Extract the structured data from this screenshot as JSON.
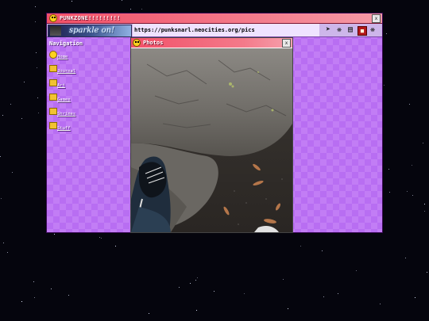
{
  "window": {
    "title": "PUNKZONE!!!!!!!!!",
    "close_label": "x"
  },
  "addressbar": {
    "banner_text": "sparkle on!",
    "url": "https://punksnarl.neocities.org/pics",
    "tools": [
      "cursor-icon",
      "bug-icon",
      "book-icon",
      "robot-icon",
      "spider-icon"
    ]
  },
  "navigation": {
    "heading": "Navigation",
    "items": [
      {
        "label": "Home",
        "icon": "smiley-icon"
      },
      {
        "label": "Journal",
        "icon": "folder-icon"
      },
      {
        "label": "Art",
        "icon": "folder-icon"
      },
      {
        "label": "Games",
        "icon": "folder-icon"
      },
      {
        "label": "Shrines",
        "icon": "folder-icon"
      },
      {
        "label": "Stuff",
        "icon": "folder-icon"
      }
    ]
  },
  "photos_window": {
    "title": "Photos",
    "close_label": "x"
  },
  "colors": {
    "titlebar": "#f25068",
    "checker_a": "#c27df5",
    "checker_b": "#b86ef2",
    "space": "#05050d"
  }
}
